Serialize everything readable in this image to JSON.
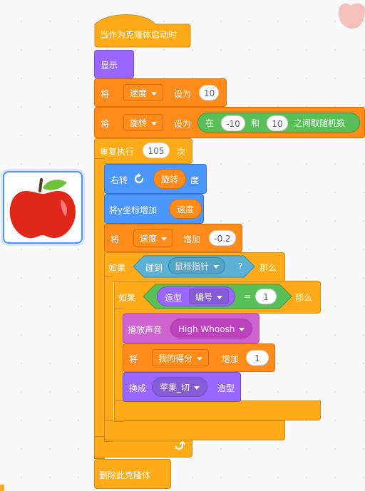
{
  "script": {
    "hat_label": "当作为克隆体启动时",
    "show_label": "显示",
    "set_speed": {
      "prefix": "将",
      "var": "速度",
      "mid": "设为",
      "value": "10"
    },
    "set_rotate": {
      "prefix": "将",
      "var": "旋转",
      "mid": "设为",
      "op_prefix": "在",
      "from": "-10",
      "op_mid": "和",
      "to": "10",
      "op_suffix": "之间取随机数"
    },
    "repeat": {
      "label": "重复执行",
      "count": "105",
      "suffix": "次"
    },
    "turn_right": {
      "label": "右转",
      "reporter": "旋转",
      "suffix": "度"
    },
    "change_y": {
      "label": "将y坐标增加",
      "reporter": "速度"
    },
    "change_speed": {
      "prefix": "将",
      "var": "速度",
      "mid": "增加",
      "value": "-0.2"
    },
    "if_touch": {
      "if_label": "如果",
      "sensing": "碰到",
      "target": "鼠标指针",
      "question": "?",
      "then_label": "那么"
    },
    "if_costume": {
      "if_label": "如果",
      "look_label": "造型",
      "look_option": "编号",
      "eq": "=",
      "value": "1",
      "then_label": "那么"
    },
    "play_sound": {
      "label": "播放声音",
      "sound": "High Whoosh"
    },
    "change_score": {
      "prefix": "将",
      "var": "我的得分",
      "mid": "增加",
      "value": "1"
    },
    "switch_costume": {
      "label": "换成",
      "costume": "苹果_切",
      "suffix": "造型"
    },
    "delete_clone": {
      "label": "删除此克隆体"
    }
  },
  "colors": {
    "events": "#ffab19",
    "control": "#ffab19",
    "variables": "#ff8c1a",
    "looks": "#9966ff",
    "motion": "#4c97ff",
    "sound": "#cf63cf",
    "sensing": "#5cb1d6",
    "operators": "#59c059"
  },
  "icons": {
    "sprite": "apple-icon",
    "turn": "rotate-right-icon",
    "loop": "loop-arrow-icon"
  }
}
